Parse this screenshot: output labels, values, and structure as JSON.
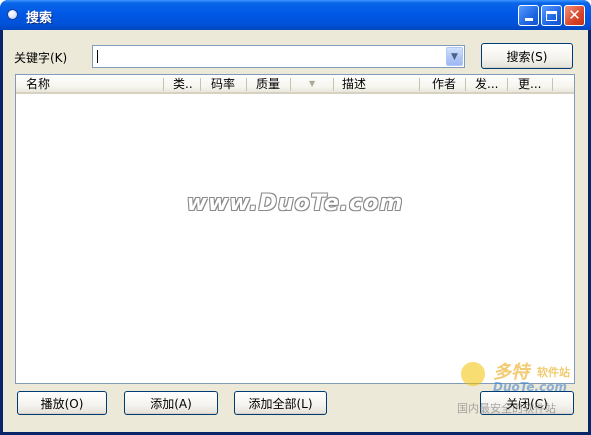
{
  "window": {
    "title": "搜索"
  },
  "search": {
    "keyword_label": "关键字(K)",
    "keyword_value": "",
    "search_button": "搜索(S)"
  },
  "table": {
    "columns": [
      "名称",
      "类..",
      "码率",
      "质量",
      "描述",
      "作者",
      "发...",
      "更..."
    ]
  },
  "watermark": {
    "center_text": "www.DuoTe.com",
    "logo_line1": "多特",
    "logo_line1b": "软件站",
    "logo_line2": "DuoTe.com",
    "logo_line3": "国内最安全的软件站"
  },
  "footer": {
    "play_button": "播放(O)",
    "add_button": "添加(A)",
    "add_all_button": "添加全部(L)",
    "close_button": "关闭(C)"
  },
  "colors": {
    "titlebar": "#0058e6",
    "dialog_bg": "#ece9d8",
    "close_button": "#d9452a"
  }
}
